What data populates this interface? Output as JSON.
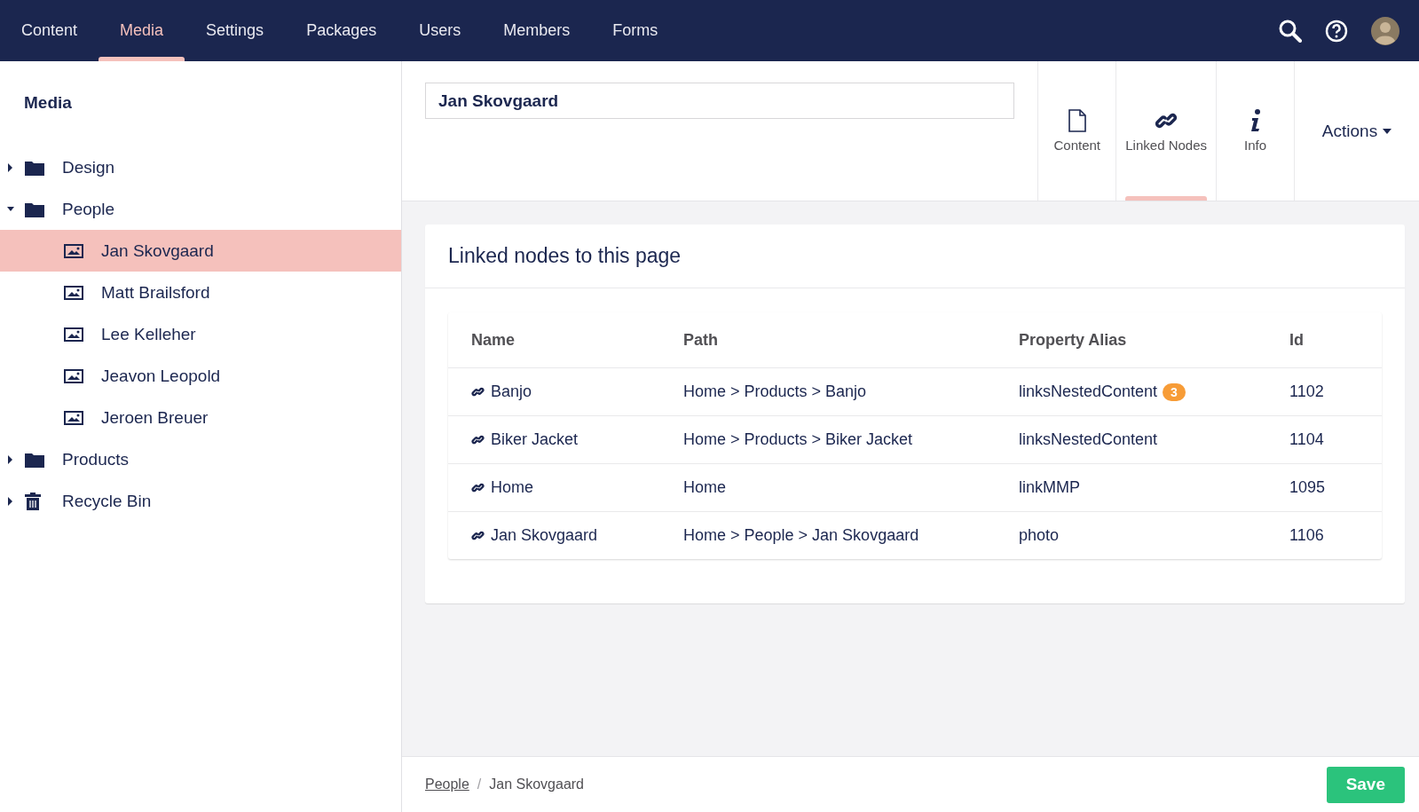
{
  "top_nav": {
    "sections": [
      {
        "label": "Content",
        "selected": false
      },
      {
        "label": "Media",
        "selected": true
      },
      {
        "label": "Settings",
        "selected": false
      },
      {
        "label": "Packages",
        "selected": false
      },
      {
        "label": "Users",
        "selected": false
      },
      {
        "label": "Members",
        "selected": false
      },
      {
        "label": "Forms",
        "selected": false
      }
    ]
  },
  "sidebar": {
    "title": "Media",
    "tree": [
      {
        "label": "Design",
        "kind": "folder",
        "expanded": false,
        "selected": false
      },
      {
        "label": "People",
        "kind": "folder",
        "expanded": true,
        "selected": false,
        "children": [
          {
            "label": "Jan Skovgaard",
            "kind": "image",
            "selected": true
          },
          {
            "label": "Matt Brailsford",
            "kind": "image",
            "selected": false
          },
          {
            "label": "Lee Kelleher",
            "kind": "image",
            "selected": false
          },
          {
            "label": "Jeavon Leopold",
            "kind": "image",
            "selected": false
          },
          {
            "label": "Jeroen Breuer",
            "kind": "image",
            "selected": false
          }
        ]
      },
      {
        "label": "Products",
        "kind": "folder",
        "expanded": false,
        "selected": false
      },
      {
        "label": "Recycle Bin",
        "kind": "bin",
        "expanded": false,
        "selected": false
      }
    ]
  },
  "editor": {
    "name_field": {
      "value": "Jan Skovgaard"
    },
    "apps": [
      {
        "label": "Content",
        "kind": "document",
        "selected": false
      },
      {
        "label": "Linked Nodes",
        "kind": "link",
        "selected": true
      },
      {
        "label": "Info",
        "kind": "info",
        "selected": false
      }
    ],
    "actions": {
      "label": "Actions"
    }
  },
  "panel": {
    "title": "Linked nodes to this page",
    "table": {
      "columns": [
        "Name",
        "Path",
        "Property Alias",
        "Id"
      ],
      "rows": [
        {
          "name": "Banjo",
          "path": "Home > Products > Banjo",
          "alias": "linksNestedContent",
          "count": "3",
          "id": "1102"
        },
        {
          "name": "Biker Jacket",
          "path": "Home > Products > Biker Jacket",
          "alias": "linksNestedContent",
          "id": "1104"
        },
        {
          "name": "Home",
          "path": "Home",
          "alias": "linkMMP",
          "id": "1095"
        },
        {
          "name": "Jan Skovgaard",
          "path": "Home > People > Jan Skovgaard",
          "alias": "photo",
          "id": "1106"
        }
      ]
    }
  },
  "footer": {
    "breadcrumb": [
      {
        "label": "People",
        "kind": "link"
      },
      {
        "label": "Jan Skovgaard",
        "kind": "current"
      }
    ],
    "breadcrumb_separator": "/",
    "save_button": "Save"
  }
}
